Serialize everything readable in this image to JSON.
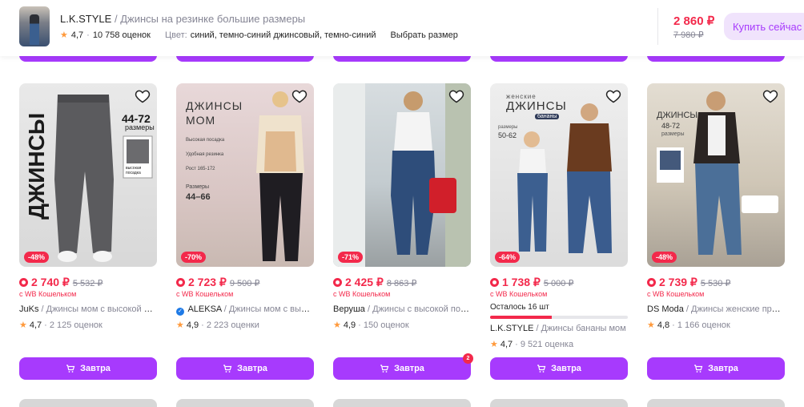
{
  "header": {
    "brand": "L.K.STYLE",
    "separator": "/",
    "product_name": "Джинсы на резинке большие размеры",
    "rating": "4,7",
    "reviews": "10 758 оценок",
    "color_label": "Цвет:",
    "color_value": "синий, темно-синий джинсовый, темно-синий",
    "size_link": "Выбрать размер",
    "price": "2 860 ₽",
    "old_price": "7 980 ₽",
    "buy_label": "Купить сейчас"
  },
  "cards": [
    {
      "discount": "-48%",
      "price": "2 740 ₽",
      "old_price": "5 532 ₽",
      "wallet": "с WB Кошельком",
      "brand": "JuKs",
      "name": "/ Джинсы мом с высокой посадкой",
      "rating": "4,7",
      "reviews": "2 125 оценок",
      "button": "Завтра",
      "photo_texts": [
        "ДЖИНСЫ",
        "44-72",
        "размеры",
        "высокая посадка"
      ]
    },
    {
      "discount": "-70%",
      "price": "2 723 ₽",
      "old_price": "9 500 ₽",
      "wallet": "с WB Кошельком",
      "brand": "ALEKSA",
      "name": "/ Джинсы мом с высокой посадкой",
      "verified": true,
      "rating": "4,9",
      "reviews": "2 223 оценки",
      "button": "Завтра",
      "photo_texts": [
        "ДЖИНСЫ",
        "МОМ",
        "Высокая посадка",
        "Удобная резинка",
        "Рост 165-172",
        "Размеры",
        "44–66"
      ]
    },
    {
      "discount": "-71%",
      "price": "2 425 ₽",
      "old_price": "8 863 ₽",
      "wallet": "с WB Кошельком",
      "brand": "Веруша",
      "name": "/ Джинсы с высокой посадкой",
      "rating": "4,9",
      "reviews": "150 оценок",
      "button": "Завтра",
      "badge": "2",
      "photo_texts": []
    },
    {
      "discount": "-64%",
      "price": "1 738 ₽",
      "old_price": "5 000 ₽",
      "wallet": "с WB Кошельком",
      "stock": "Осталось 16 шт",
      "stock_level": 0.45,
      "brand": "L.K.STYLE",
      "name": "/ Джинсы бананы мом",
      "rating": "4,7",
      "reviews": "9 521 оценка",
      "button": "Завтра",
      "photo_texts": [
        "женские",
        "ДЖИНСЫ",
        "бананы",
        "размеры",
        "50-62"
      ]
    },
    {
      "discount": "-48%",
      "price": "2 739 ₽",
      "old_price": "5 530 ₽",
      "wallet": "с WB Кошельком",
      "brand": "DS Moda",
      "name": "/ Джинсы женские прямые",
      "rating": "4,8",
      "reviews": "1 166 оценок",
      "button": "Завтра",
      "photo_texts": [
        "ДЖИНСЫ",
        "48-72",
        "размеры"
      ]
    }
  ],
  "colors": {
    "accent": "#a73afd",
    "price": "#f3294b",
    "muted": "#868695",
    "star": "#ff9a3c"
  }
}
